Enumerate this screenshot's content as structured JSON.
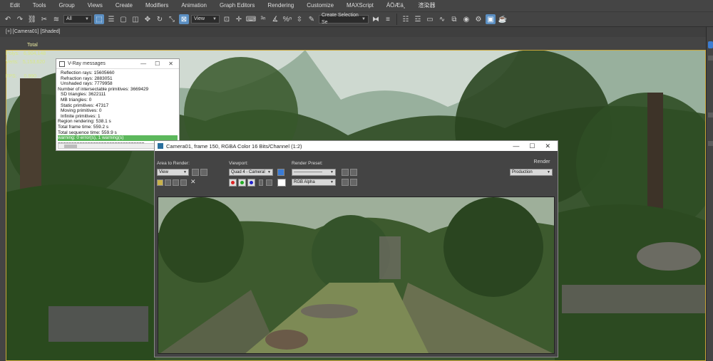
{
  "menubar": {
    "items": [
      "Edit",
      "Tools",
      "Group",
      "Views",
      "Create",
      "Modifiers",
      "Animation",
      "Graph Editors",
      "Rendering",
      "Customize",
      "MAXScript",
      "ÁÖÆä¸",
      "渲染器"
    ]
  },
  "toolbar": {
    "selection_filter": "All",
    "reference_coord": "View",
    "named_selection": "Create Selection Se"
  },
  "viewport": {
    "label": "[+] [Camera01] [Shaded]"
  },
  "stats": {
    "total_label": "Total",
    "polys_label": "Polys:",
    "polys_value": "6,904,148",
    "verts_label": "Verts:",
    "verts_value": "5,153,620",
    "fps_label": "FPS:",
    "fps_value": "0.990"
  },
  "vray_messages": {
    "title": "V-Ray messages",
    "lines": [
      "Reflection rays: 15605660",
      "Refraction rays: 2883051",
      "Unshaded rays: 7779958",
      "Number of intersectable primitives: 3669429",
      "SD triangles: 3622111",
      "MB triangles: 0",
      "Static primitives: 47317",
      "Moving primitives: 0",
      "Infinite primitives: 1",
      "Region rendering: 538.1 s",
      "Total frame time: 559.2 s",
      "Total sequence time: 559.9 s"
    ],
    "warning": "warning: 0 error(s), 1 warning(s)",
    "separator": "================================"
  },
  "frame_buffer": {
    "title": "Camera01, frame 150, RGBA Color 16 Bits/Channel (1:2)",
    "area_label": "Area to Render:",
    "area_value": "View",
    "viewport_label": "Viewport:",
    "viewport_value": "Quad 4 - Cameral",
    "preset_label": "Render Preset:",
    "preset_value": "--------------------",
    "render_button": "Render",
    "render_mode": "Production",
    "channel": "RGB Alpha"
  },
  "colors": {
    "accent": "#5b8fc2",
    "viewport_border": "#c9a63a",
    "warning_bar": "#5cb85c"
  }
}
